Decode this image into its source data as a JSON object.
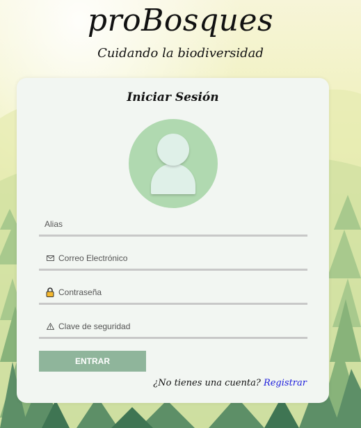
{
  "brand": {
    "title": "proBosques",
    "subtitle": "Cuidando la biodiversidad"
  },
  "login": {
    "title": "Iniciar Sesión",
    "fields": {
      "alias": {
        "placeholder": "Alias",
        "icon": "none"
      },
      "email": {
        "placeholder": "Correo Electrónico",
        "icon": "envelope-icon"
      },
      "password": {
        "placeholder": "Contraseña",
        "icon": "lock-icon"
      },
      "security": {
        "placeholder": "Clave de seguridad",
        "icon": "warning-icon"
      }
    },
    "submit_label": "ENTRAR",
    "no_account_text": "¿No tienes una cuenta?",
    "register_link": "Registrar"
  },
  "colors": {
    "button": "#8fb59b",
    "avatar_bg": "#b0d9b0",
    "link": "#1a1adc",
    "card_bg": "#f2f6f2"
  }
}
